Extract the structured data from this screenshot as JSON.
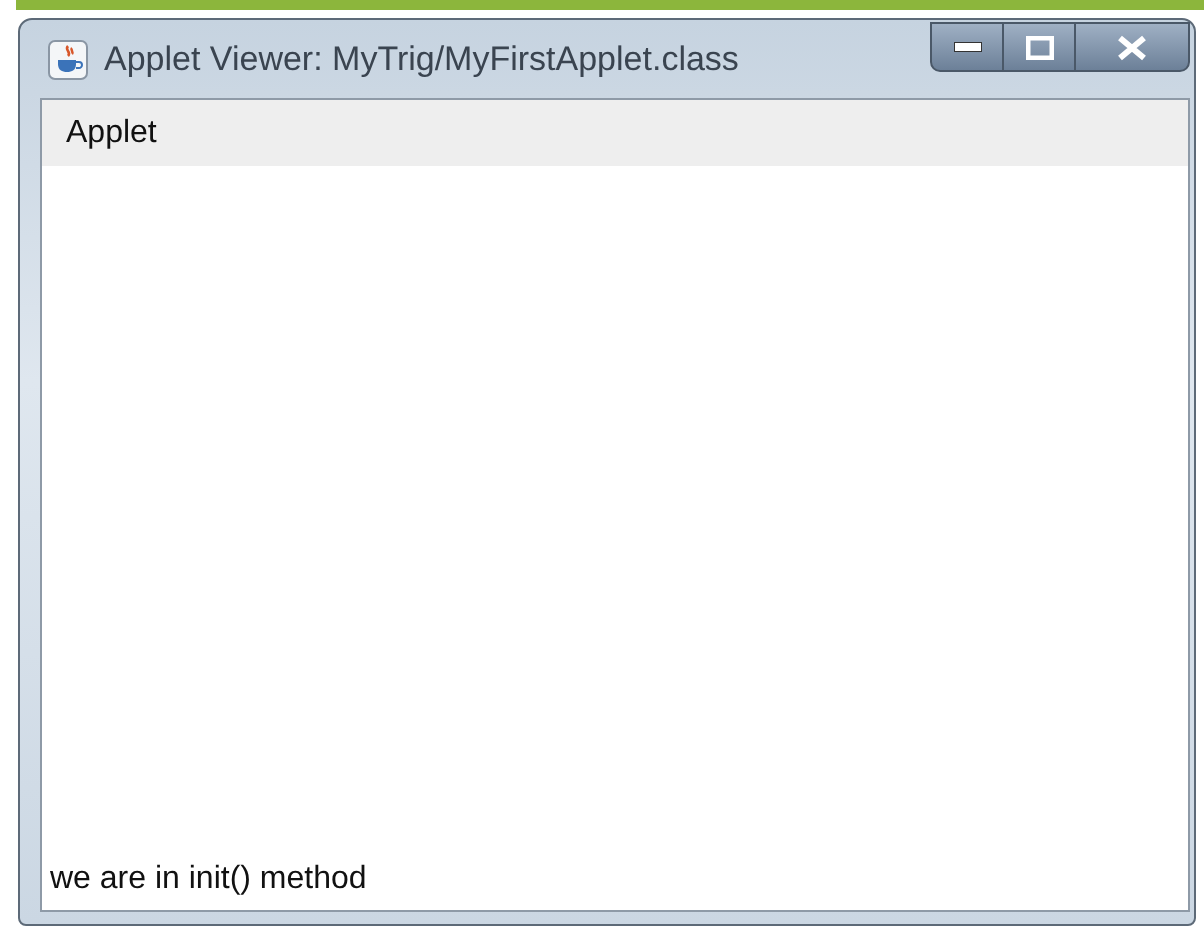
{
  "window": {
    "title": "Applet Viewer: MyTrig/MyFirstApplet.class"
  },
  "menu_bar": {
    "items": [
      "Applet"
    ]
  },
  "applet": {
    "status": "we are in init() method"
  }
}
